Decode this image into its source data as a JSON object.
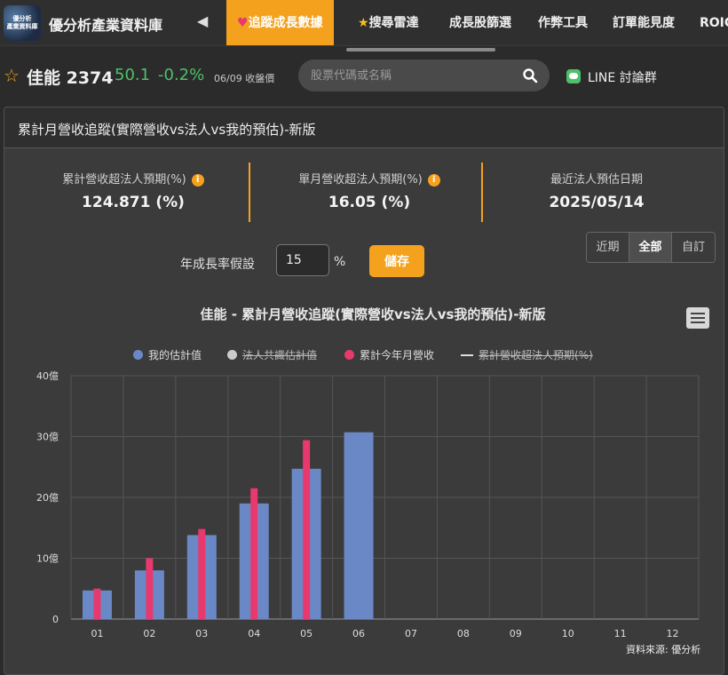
{
  "topnav": {
    "logo_line1": "優分析",
    "logo_line2": "產業資料庫",
    "brand": "優分析產業資料庫",
    "items": [
      {
        "label": "追蹤成長數據",
        "active": true
      },
      {
        "label": "搜尋雷達",
        "active": false
      },
      {
        "label": "成長股篩選",
        "active": false
      },
      {
        "label": "作弊工具",
        "active": false
      },
      {
        "label": "訂單能見度",
        "active": false
      },
      {
        "label": "ROIC",
        "active": false
      }
    ]
  },
  "stock": {
    "name": "佳能 2374",
    "price": "50.1",
    "change": "-0.2%",
    "date": "06/09 收盤價"
  },
  "search": {
    "placeholder": "股票代碼或名稱"
  },
  "line": {
    "label": "LINE 討論群"
  },
  "panel": {
    "title": "累計月營收追蹤(實際營收vs法人vs我的預估)-新版",
    "stats": [
      {
        "label": "累計營收超法人預期(%)",
        "value": "124.871 (%)",
        "info": true
      },
      {
        "label": "單月營收超法人預期(%)",
        "value": "16.05 (%)",
        "info": true
      },
      {
        "label": "最近法人預估日期",
        "value": "2025/05/14",
        "info": false
      }
    ],
    "segments": [
      "近期",
      "全部",
      "自訂"
    ],
    "active_segment": "全部",
    "growth_label": "年成長率假設",
    "growth_value": "15",
    "growth_unit": "%",
    "save_label": "儲存"
  },
  "credit": "資料來源: 優分析",
  "chart_data": {
    "type": "bar",
    "title": "佳能 - 累計月營收追蹤(實際營收vs法人vs我的預估)-新版",
    "categories": [
      "01",
      "02",
      "03",
      "04",
      "05",
      "06",
      "07",
      "08",
      "09",
      "10",
      "11",
      "12"
    ],
    "y_unit": "億",
    "ylim": [
      0,
      40
    ],
    "yticks": [
      "0",
      "10億",
      "20億",
      "30億",
      "40億"
    ],
    "grid": true,
    "legend_position": "top",
    "series": [
      {
        "name": "我的估計值",
        "color": "#6b88c6",
        "visible": true,
        "values": [
          4.7,
          8.0,
          13.8,
          19.0,
          24.7,
          30.7,
          null,
          null,
          null,
          null,
          null,
          null
        ]
      },
      {
        "name": "法人共識估計值",
        "color": "#cccccc",
        "visible": false,
        "values": []
      },
      {
        "name": "累計今年月營收",
        "color": "#e8396f",
        "visible": true,
        "values": [
          5.0,
          10.0,
          14.8,
          21.5,
          29.4,
          null,
          null,
          null,
          null,
          null,
          null,
          null
        ]
      },
      {
        "name": "累計營收超法人預期(%)",
        "color": "#dddddd",
        "visible": false,
        "values": []
      }
    ]
  }
}
